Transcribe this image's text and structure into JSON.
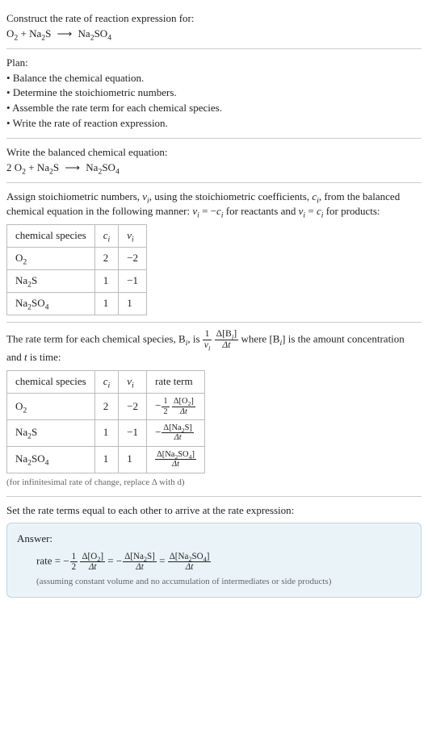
{
  "s1": {
    "prompt": "Construct the rate of reaction expression for:",
    "reaction_lhs1": "O",
    "reaction_lhs1_sub": "2",
    "plus": " + ",
    "reaction_lhs2a": "Na",
    "reaction_lhs2a_sub": "2",
    "reaction_lhs2b": "S",
    "arrow": "⟶",
    "reaction_rhs_a": "Na",
    "reaction_rhs_a_sub": "2",
    "reaction_rhs_b": "SO",
    "reaction_rhs_b_sub": "4"
  },
  "s2": {
    "heading": "Plan:",
    "b1": "Balance the chemical equation.",
    "b2": "Determine the stoichiometric numbers.",
    "b3": "Assemble the rate term for each chemical species.",
    "b4": "Write the rate of reaction expression."
  },
  "s3": {
    "heading": "Write the balanced chemical equation:",
    "coef1": "2 ",
    "lhs1": "O",
    "lhs1_sub": "2",
    "plus": " + ",
    "lhs2a": "Na",
    "lhs2a_sub": "2",
    "lhs2b": "S",
    "arrow": "⟶",
    "rhs_a": "Na",
    "rhs_a_sub": "2",
    "rhs_b": "SO",
    "rhs_b_sub": "4"
  },
  "s4": {
    "text1": "Assign stoichiometric numbers, ",
    "nu_i": "ν",
    "nu_i_sub": "i",
    "text2": ", using the stoichiometric coefficients, ",
    "c_i": "c",
    "c_i_sub": "i",
    "text3": ", from the balanced chemical equation in the following manner: ",
    "eq1_l": "ν",
    "eq1_l_sub": "i",
    "eq1_m": " = −",
    "eq1_r": "c",
    "eq1_r_sub": "i",
    "text4": " for reactants and ",
    "eq2_l": "ν",
    "eq2_l_sub": "i",
    "eq2_m": " = ",
    "eq2_r": "c",
    "eq2_r_sub": "i",
    "text5": " for products:",
    "th1": "chemical species",
    "th2_a": "c",
    "th2_b": "i",
    "th3_a": "ν",
    "th3_b": "i",
    "r1_sp_a": "O",
    "r1_sp_b": "2",
    "r1_c": "2",
    "r1_v": "−2",
    "r2_sp_a": "Na",
    "r2_sp_b": "2",
    "r2_sp_c": "S",
    "r2_c": "1",
    "r2_v": "−1",
    "r3_sp_a": "Na",
    "r3_sp_b": "2",
    "r3_sp_c": "SO",
    "r3_sp_d": "4",
    "r3_c": "1",
    "r3_v": "1"
  },
  "s5": {
    "text1": "The rate term for each chemical species, B",
    "text1_sub": "i",
    "text2": ", is ",
    "f1_num": "1",
    "f1_den_a": "ν",
    "f1_den_b": "i",
    "f2_num_a": "Δ[B",
    "f2_num_b": "i",
    "f2_num_c": "]",
    "f2_den": "Δt",
    "text3": " where [B",
    "text3_sub": "i",
    "text4": "] is the amount concentration and ",
    "t_var": "t",
    "text5": " is time:",
    "th1": "chemical species",
    "th2_a": "c",
    "th2_b": "i",
    "th3_a": "ν",
    "th3_b": "i",
    "th4": "rate term",
    "r1_sp_a": "O",
    "r1_sp_b": "2",
    "r1_c": "2",
    "r1_v": "−2",
    "r1_rt_neg": "−",
    "r1_rt_f1n": "1",
    "r1_rt_f1d": "2",
    "r1_rt_f2n_a": "Δ[O",
    "r1_rt_f2n_b": "2",
    "r1_rt_f2n_c": "]",
    "r1_rt_f2d": "Δt",
    "r2_sp_a": "Na",
    "r2_sp_b": "2",
    "r2_sp_c": "S",
    "r2_c": "1",
    "r2_v": "−1",
    "r2_rt_neg": "−",
    "r2_rt_f2n_a": "Δ[Na",
    "r2_rt_f2n_b": "2",
    "r2_rt_f2n_c": "S]",
    "r2_rt_f2d": "Δt",
    "r3_sp_a": "Na",
    "r3_sp_b": "2",
    "r3_sp_c": "SO",
    "r3_sp_d": "4",
    "r3_c": "1",
    "r3_v": "1",
    "r3_rt_f2n_a": "Δ[Na",
    "r3_rt_f2n_b": "2",
    "r3_rt_f2n_c": "SO",
    "r3_rt_f2n_d": "4",
    "r3_rt_f2n_e": "]",
    "r3_rt_f2d": "Δt",
    "note": "(for infinitesimal rate of change, replace Δ with d)"
  },
  "s6": {
    "heading": "Set the rate terms equal to each other to arrive at the rate expression:",
    "answer_label": "Answer:",
    "rate_word": "rate = ",
    "t1_neg": "−",
    "t1_f1n": "1",
    "t1_f1d": "2",
    "t1_f2n_a": "Δ[O",
    "t1_f2n_b": "2",
    "t1_f2n_c": "]",
    "t1_f2d": "Δt",
    "eq": " = ",
    "t2_neg": "−",
    "t2_f2n_a": "Δ[Na",
    "t2_f2n_b": "2",
    "t2_f2n_c": "S]",
    "t2_f2d": "Δt",
    "t3_f2n_a": "Δ[Na",
    "t3_f2n_b": "2",
    "t3_f2n_c": "SO",
    "t3_f2n_d": "4",
    "t3_f2n_e": "]",
    "t3_f2d": "Δt",
    "assumption": "(assuming constant volume and no accumulation of intermediates or side products)"
  }
}
